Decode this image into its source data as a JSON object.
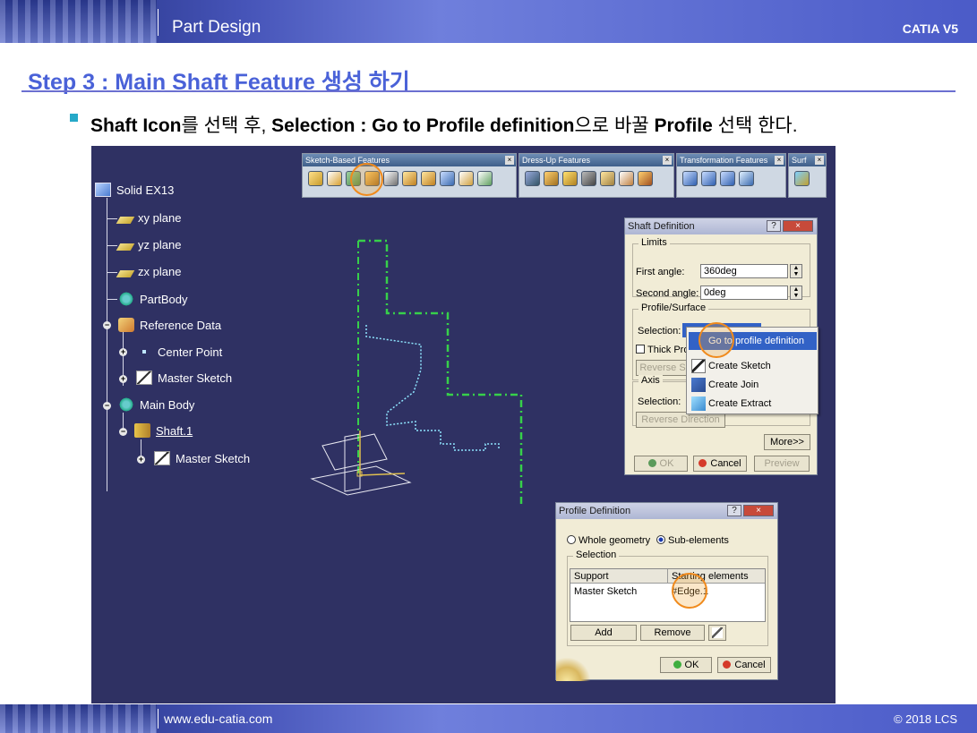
{
  "header": {
    "section": "Part Design",
    "brand": "CATIA V5"
  },
  "step_title": "Step 3 : Main Shaft Feature 생성 하기",
  "instruction": {
    "p1": "Shaft Icon",
    "p2": "를 선택 후, ",
    "p3": "Selection : Go to Profile definition",
    "p4": "으로 바꿀 ",
    "p5": "Profile",
    "p6": " 선택 한다."
  },
  "tree": {
    "root": "Solid EX13",
    "xy": "xy plane",
    "yz": "yz plane",
    "zx": "zx plane",
    "partbody": "PartBody",
    "refdata": "Reference Data",
    "centerpoint": "Center Point",
    "mastersketch1": "Master Sketch",
    "mainbody": "Main Body",
    "shaft": "Shaft.1",
    "mastersketch2": "Master Sketch"
  },
  "toolbars": {
    "sketch": "Sketch-Based Features",
    "dressup": "Dress-Up Features",
    "transform": "Transformation Features",
    "surf": "Surf"
  },
  "shaft_dialog": {
    "title": "Shaft Definition",
    "limits": "Limits",
    "first_angle_label": "First angle:",
    "first_angle": "360deg",
    "second_angle_label": "Second angle:",
    "second_angle": "0deg",
    "profile_surface": "Profile/Surface",
    "selection_label": "Selection:",
    "thick": "Thick Pro",
    "reverse": "Reverse S",
    "axis": "Axis",
    "axis_selection": "Selection:",
    "reverse_dir": "Reverse Direction",
    "more": "More>>",
    "ok": "OK",
    "cancel": "Cancel",
    "preview": "Preview"
  },
  "context_menu": {
    "goto": "Go to profile definition",
    "create_sketch": "Create Sketch",
    "create_join": "Create Join",
    "create_extract": "Create Extract"
  },
  "profile_dialog": {
    "title": "Profile Definition",
    "whole": "Whole geometry",
    "sub": "Sub-elements",
    "selection": "Selection",
    "col_support": "Support",
    "col_starting": "Starting elements",
    "row_support": "Master Sketch",
    "row_starting": "#Edge.1",
    "add": "Add",
    "remove": "Remove",
    "ok": "OK",
    "cancel": "Cancel"
  },
  "footer": {
    "url": "www.edu-catia.com",
    "copyright": "© 2018 LCS"
  },
  "colors": {
    "accent": "#4a62d8",
    "viewport": "#2f3163",
    "highlight": "#f08a1c",
    "sketch_green": "#37d04a",
    "profile_cyan": "#8fe6ff"
  }
}
